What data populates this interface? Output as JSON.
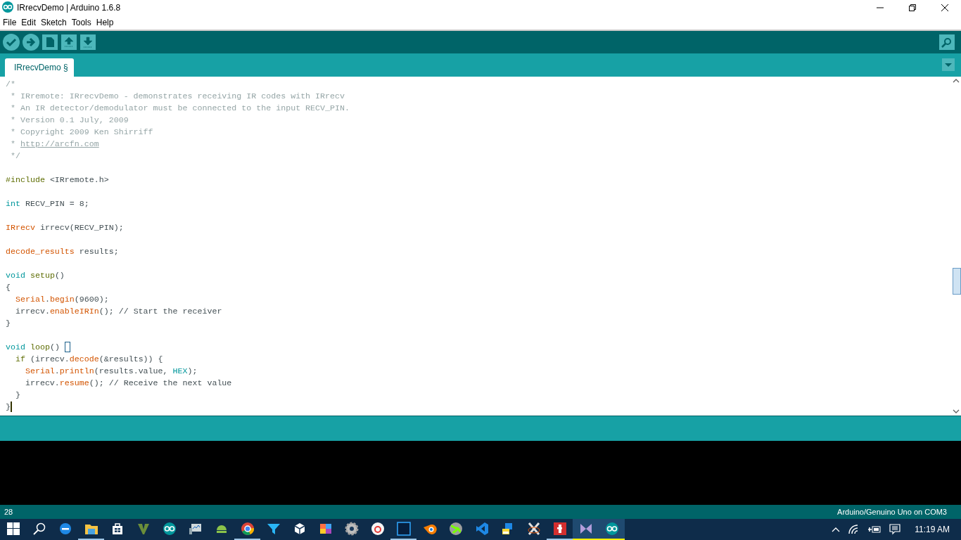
{
  "window": {
    "title": "IRrecvDemo | Arduino 1.6.8"
  },
  "menu": [
    "File",
    "Edit",
    "Sketch",
    "Tools",
    "Help"
  ],
  "toolbar": [
    {
      "kind": "verify"
    },
    {
      "kind": "upload"
    },
    {
      "kind": "new"
    },
    {
      "kind": "open"
    },
    {
      "kind": "save"
    }
  ],
  "tabs": [
    {
      "label": "IRrecvDemo §",
      "selected": true
    }
  ],
  "code": [
    {
      "kind": "code",
      "tokens": [
        {
          "kind": "comment",
          "text": "/*"
        }
      ]
    },
    {
      "kind": "code",
      "tokens": [
        {
          "kind": "comment",
          "text": " * IRremote: IRrecvDemo - demonstrates receiving IR codes with IRrecv"
        }
      ]
    },
    {
      "kind": "code",
      "tokens": [
        {
          "kind": "comment",
          "text": " * An IR detector/demodulator must be connected to the input RECV_PIN."
        }
      ]
    },
    {
      "kind": "code",
      "tokens": [
        {
          "kind": "comment",
          "text": " * Version 0.1 July, 2009"
        }
      ]
    },
    {
      "kind": "code",
      "tokens": [
        {
          "kind": "comment",
          "text": " * Copyright 2009 Ken Shirriff"
        }
      ]
    },
    {
      "kind": "code",
      "tokens": [
        {
          "kind": "comment",
          "text": " * "
        },
        {
          "kind": "link",
          "text": "http://arcfn.com"
        }
      ]
    },
    {
      "kind": "code",
      "tokens": [
        {
          "kind": "comment",
          "text": " */"
        }
      ]
    },
    {
      "kind": "blank"
    },
    {
      "kind": "code",
      "tokens": [
        {
          "kind": "structure",
          "text": "#include"
        },
        {
          "kind": "plain",
          "text": " <IRremote.h>"
        }
      ]
    },
    {
      "kind": "blank"
    },
    {
      "kind": "code",
      "tokens": [
        {
          "kind": "keyword",
          "text": "int"
        },
        {
          "kind": "plain",
          "text": " RECV_PIN = 8;"
        }
      ]
    },
    {
      "kind": "blank"
    },
    {
      "kind": "code",
      "tokens": [
        {
          "kind": "type",
          "text": "IRrecv"
        },
        {
          "kind": "plain",
          "text": " irrecv(RECV_PIN);"
        }
      ]
    },
    {
      "kind": "blank"
    },
    {
      "kind": "code",
      "tokens": [
        {
          "kind": "type",
          "text": "decode_results"
        },
        {
          "kind": "plain",
          "text": " results;"
        }
      ]
    },
    {
      "kind": "blank"
    },
    {
      "kind": "code",
      "tokens": [
        {
          "kind": "keyword",
          "text": "void "
        },
        {
          "kind": "structure",
          "text": "setup"
        },
        {
          "kind": "plain",
          "text": "()"
        }
      ]
    },
    {
      "kind": "code",
      "tokens": [
        {
          "kind": "plain",
          "text": "{"
        }
      ]
    },
    {
      "kind": "code",
      "tokens": [
        {
          "kind": "type",
          "text": "  Serial"
        },
        {
          "kind": "plain",
          "text": "."
        },
        {
          "kind": "type",
          "text": "begin"
        },
        {
          "kind": "plain",
          "text": "(9600);"
        }
      ]
    },
    {
      "kind": "code",
      "tokens": [
        {
          "kind": "plain",
          "text": "  irrecv."
        },
        {
          "kind": "type",
          "text": "enableIRIn"
        },
        {
          "kind": "plain",
          "text": "(); // Start the receiver"
        }
      ]
    },
    {
      "kind": "code",
      "tokens": [
        {
          "kind": "plain",
          "text": "}"
        }
      ]
    },
    {
      "kind": "blank"
    },
    {
      "kind": "code",
      "bracket_highlight": true,
      "tokens": [
        {
          "kind": "keyword",
          "text": "void "
        },
        {
          "kind": "structure",
          "text": "loop"
        },
        {
          "kind": "plain",
          "text": "() "
        }
      ]
    },
    {
      "kind": "code",
      "tokens": [
        {
          "kind": "structure",
          "text": "  if"
        },
        {
          "kind": "plain",
          "text": " (irrecv."
        },
        {
          "kind": "type",
          "text": "decode"
        },
        {
          "kind": "plain",
          "text": "(&results)) {"
        }
      ]
    },
    {
      "kind": "code",
      "tokens": [
        {
          "kind": "type",
          "text": "    Serial"
        },
        {
          "kind": "plain",
          "text": "."
        },
        {
          "kind": "type",
          "text": "println"
        },
        {
          "kind": "plain",
          "text": "(results.value, "
        },
        {
          "kind": "keyword",
          "text": "HEX"
        },
        {
          "kind": "plain",
          "text": ");"
        }
      ]
    },
    {
      "kind": "code",
      "tokens": [
        {
          "kind": "plain",
          "text": "    irrecv."
        },
        {
          "kind": "type",
          "text": "resume"
        },
        {
          "kind": "plain",
          "text": "(); // Receive the next value"
        }
      ]
    },
    {
      "kind": "code",
      "tokens": [
        {
          "kind": "plain",
          "text": "  }"
        }
      ]
    },
    {
      "kind": "code",
      "cursor": true,
      "tokens": [
        {
          "kind": "plain",
          "text": "}"
        }
      ]
    }
  ],
  "status_bar": {
    "line": "28",
    "board": "Arduino/Genuino Uno on COM3"
  },
  "taskbar": {
    "apps": [
      {
        "kind": "edge",
        "running": false,
        "selected": false
      },
      {
        "kind": "folder",
        "running": true,
        "selected": false
      },
      {
        "kind": "store",
        "running": false,
        "selected": false
      },
      {
        "kind": "v",
        "running": false,
        "selected": false
      },
      {
        "kind": "arduino",
        "running": false,
        "selected": false
      },
      {
        "kind": "monitor",
        "running": false,
        "selected": false
      },
      {
        "kind": "android",
        "running": false,
        "selected": false
      },
      {
        "kind": "chrome",
        "running": true,
        "selected": false
      },
      {
        "kind": "funnel",
        "running": false,
        "selected": false
      },
      {
        "kind": "unity",
        "running": false,
        "selected": false
      },
      {
        "kind": "puzzle",
        "running": false,
        "selected": false
      },
      {
        "kind": "gear",
        "running": false,
        "selected": false
      },
      {
        "kind": "ring",
        "running": false,
        "selected": false
      },
      {
        "kind": "ps",
        "running": true,
        "selected": false
      },
      {
        "kind": "blender",
        "running": false,
        "selected": false
      },
      {
        "kind": "globe",
        "running": false,
        "selected": false
      },
      {
        "kind": "vscode",
        "running": false,
        "selected": false
      },
      {
        "kind": "python",
        "running": false,
        "selected": false
      },
      {
        "kind": "x",
        "running": false,
        "selected": false
      },
      {
        "kind": "flash",
        "running": true,
        "selected": false
      },
      {
        "kind": "vs",
        "running": true,
        "selected": true
      },
      {
        "kind": "arduino",
        "running": true,
        "selected": true
      }
    ],
    "clock": "11:19 AM"
  }
}
